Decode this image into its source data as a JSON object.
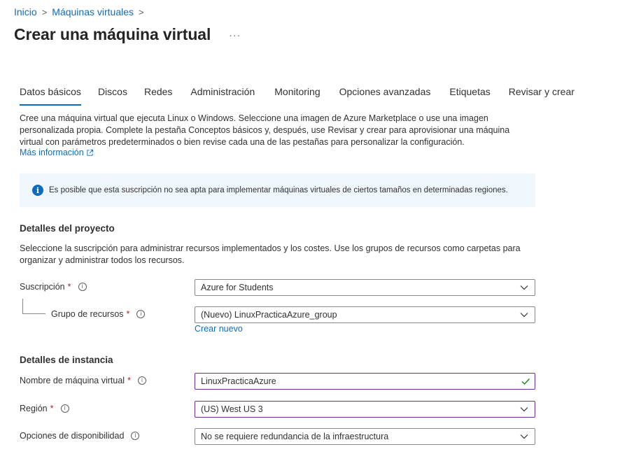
{
  "breadcrumb": {
    "items": [
      "Inicio",
      "Máquinas virtuales"
    ]
  },
  "page": {
    "title": "Crear una máquina virtual",
    "more": "···"
  },
  "tabs": [
    {
      "label": "Datos básicos",
      "active": true
    },
    {
      "label": "Discos"
    },
    {
      "label": "Redes"
    },
    {
      "label": "Administración"
    },
    {
      "label": "Monitoring"
    },
    {
      "label": "Opciones avanzadas"
    },
    {
      "label": "Etiquetas"
    },
    {
      "label": "Revisar y crear"
    }
  ],
  "intro": {
    "text": "Cree una máquina virtual que ejecuta Linux o Windows. Seleccione una imagen de Azure Marketplace o use una imagen personalizada propia. Complete la pestaña Conceptos básicos y, después, use Revisar y crear para aprovisionar una máquina virtual con parámetros predeterminados o bien revise cada una de las pestañas para personalizar la configuración.",
    "learn_more": "Más información"
  },
  "info_banner": {
    "text": "Es posible que esta suscripción no sea apta para implementar máquinas virtuales de ciertos tamaños en determinadas regiones."
  },
  "project": {
    "title": "Detalles del proyecto",
    "description": "Seleccione la suscripción para administrar recursos implementados y los costes. Use los grupos de recursos como carpetas para organizar y administrar todos los recursos.",
    "subscription_label": "Suscripción",
    "subscription_value": "Azure for Students",
    "resource_group_label": "Grupo de recursos",
    "resource_group_value": "(Nuevo) LinuxPracticaAzure_group",
    "create_new": "Crear nuevo"
  },
  "instance": {
    "title": "Detalles de instancia",
    "vm_name_label": "Nombre de máquina virtual",
    "vm_name_value": "LinuxPracticaAzure",
    "region_label": "Región",
    "region_value": "(US) West US 3",
    "availability_label": "Opciones de disponibilidad",
    "availability_value": "No se requiere redundancia de la infraestructura"
  },
  "required_marker": "*",
  "colors": {
    "accent": "#0f6cbd",
    "focus": "#6b2d9b",
    "valid": "#107c10",
    "info_bg": "#eff6fc",
    "required": "#a4262c"
  }
}
